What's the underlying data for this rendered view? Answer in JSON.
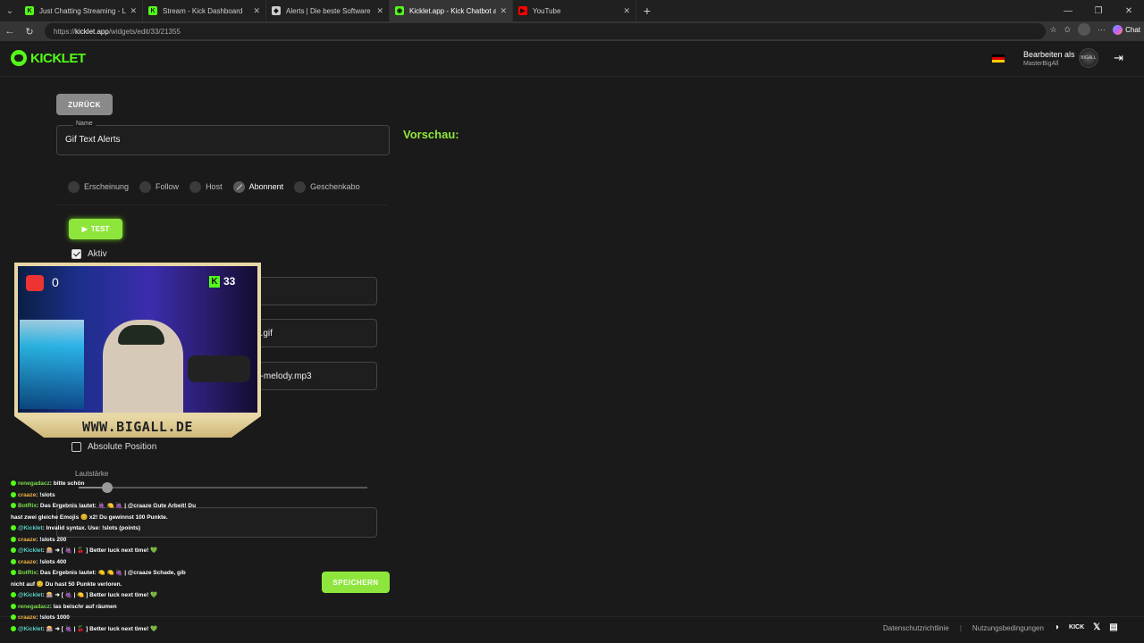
{
  "browser": {
    "tabs": [
      {
        "title": "Just Chatting Streaming - Live Strea",
        "fav_color": "#53fc18",
        "fav": "K",
        "active": false
      },
      {
        "title": "Stream - Kick Dashboard",
        "fav_color": "#53fc18",
        "fav": "K",
        "active": false
      },
      {
        "title": "Alerts | Die beste Software zur Op",
        "fav_color": "#cccccc",
        "fav": "◆",
        "active": false
      },
      {
        "title": "Kicklet.app - Kick Chatbot and Ove",
        "fav_color": "#53fc18",
        "fav": "◉",
        "active": true
      },
      {
        "title": "YouTube",
        "fav_color": "#ff0000",
        "fav": "▶",
        "active": false
      }
    ],
    "url_prefix": "https://",
    "url_host": "kicklet.app",
    "url_path": "/widgets/edit/33/21355",
    "chat_label": "Chat"
  },
  "header": {
    "logo_text": "KICKLET",
    "edit_as": "Bearbeiten als",
    "username": "MasterBigAll",
    "avatar_text": "BIGALL"
  },
  "form": {
    "back_label": "ZURÜCK",
    "name_label": "Name",
    "name_value": "Gif Text Alerts",
    "preview_label": "Vorschau:",
    "event_tabs": [
      "Erscheinung",
      "Follow",
      "Host",
      "Abonnent",
      "Geschenkabo"
    ],
    "active_tab": "Abonnent",
    "test_label": "TEST",
    "aktiv_label": "Aktiv",
    "gif_partial": "e.gif",
    "sound_partial": "e-melody.mp3",
    "absolute_label": "Absolute Position",
    "volume_label": "Lautstärke",
    "volume_level": 0.1,
    "save_label": "SPEICHERN"
  },
  "footer": {
    "privacy": "Datenschutzrichtlinie",
    "terms": "Nutzungsbedingungen",
    "kick": "KICK"
  },
  "overlay": {
    "left_count": "0",
    "right_count": "33",
    "banner": "WWW.BIGALL.DE"
  },
  "chat": [
    {
      "user": "renegadacz",
      "cls": "u-green",
      "msg": ": bitte schön"
    },
    {
      "user": "craaze",
      "cls": "u-orange",
      "msg": ": !slots"
    },
    {
      "user": "BotRix",
      "cls": "u-green",
      "msg": ": Das Ergebnis lautet: 🍇 🍋 🍇 | @craaze Gute Arbeit! Du"
    },
    {
      "user": "",
      "cls": "u-gray",
      "msg": "hast zwei gleiche Emojis 😊 x2! Du gewinnst 100 Punkte."
    },
    {
      "user": "@Kicklet",
      "cls": "u-teal",
      "msg": ": Invalid syntax. Use: !slots (points)"
    },
    {
      "user": "craaze",
      "cls": "u-orange",
      "msg": ": !slots 200"
    },
    {
      "user": "@Kicklet",
      "cls": "u-teal",
      "msg": ": 🎰 ➜ [ 🍇 | 🍒 ] Better luck next time! 💚"
    },
    {
      "user": "craaze",
      "cls": "u-orange",
      "msg": ": !slots 400"
    },
    {
      "user": "BotRix",
      "cls": "u-green",
      "msg": ": Das Ergebnis lautet: 🍋 🍋 🍇 | @craaze Schade, gib"
    },
    {
      "user": "",
      "cls": "u-gray",
      "msg": "nicht auf 😊 Du hast 50 Punkte verloren."
    },
    {
      "user": "@Kicklet",
      "cls": "u-teal",
      "msg": ": 🎰 ➜ [ 🍇 | 🍋 ] Better luck next time! 💚"
    },
    {
      "user": "renegadacz",
      "cls": "u-green",
      "msg": ": las beischr auf räumen"
    },
    {
      "user": "craaze",
      "cls": "u-orange",
      "msg": ": !slots 1000"
    },
    {
      "user": "@Kicklet",
      "cls": "u-teal",
      "msg": ": 🎰 ➜ [ 🍇 | 🍒 ] Better luck next time! 💚"
    }
  ]
}
